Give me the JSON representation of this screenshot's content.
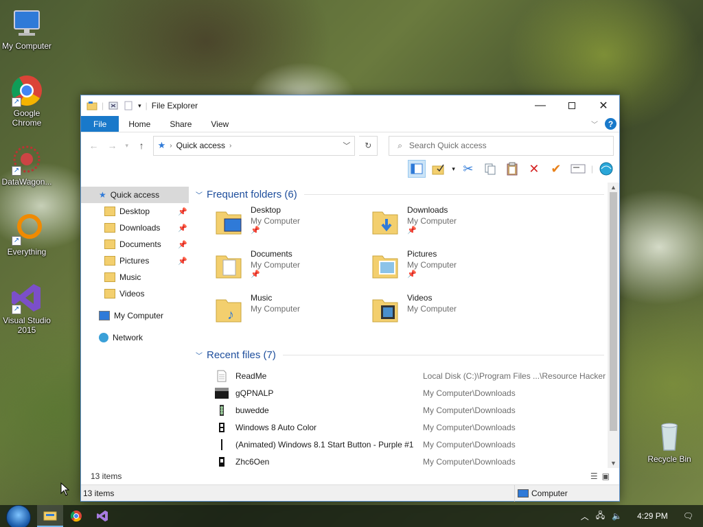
{
  "desktop": {
    "icons": [
      {
        "label": "My Computer"
      },
      {
        "label": "Google Chrome"
      },
      {
        "label": "DataWagon..."
      },
      {
        "label": "Everything"
      },
      {
        "label": "Visual Studio 2015"
      },
      {
        "label": "Recycle Bin"
      }
    ]
  },
  "window": {
    "title": "File Explorer",
    "ribbon_tabs": [
      "File",
      "Home",
      "Share",
      "View"
    ],
    "help": "?",
    "address": {
      "location": "Quick access"
    },
    "search": {
      "placeholder": "Search Quick access"
    },
    "nav": {
      "quick_access": "Quick access",
      "items": [
        "Desktop",
        "Downloads",
        "Documents",
        "Pictures",
        "Music",
        "Videos"
      ],
      "my_computer": "My Computer",
      "network": "Network"
    },
    "frequent": {
      "header": "Frequent folders (6)",
      "folders": [
        {
          "name": "Desktop",
          "location": "My Computer"
        },
        {
          "name": "Downloads",
          "location": "My Computer"
        },
        {
          "name": "Documents",
          "location": "My Computer"
        },
        {
          "name": "Pictures",
          "location": "My Computer"
        },
        {
          "name": "Music",
          "location": "My Computer"
        },
        {
          "name": "Videos",
          "location": "My Computer"
        }
      ]
    },
    "recent": {
      "header": "Recent files (7)",
      "files": [
        {
          "name": "ReadMe",
          "location": "Local Disk (C:)\\Program Files ...\\Resource Hacker"
        },
        {
          "name": "gQPNALP",
          "location": "My Computer\\Downloads"
        },
        {
          "name": "buwedde",
          "location": "My Computer\\Downloads"
        },
        {
          "name": "Windows 8 Auto Color",
          "location": "My Computer\\Downloads"
        },
        {
          "name": "(Animated) Windows 8.1 Start Button - Purple #1",
          "location": "My Computer\\Downloads"
        },
        {
          "name": "Zhc6Oen",
          "location": "My Computer\\Downloads"
        }
      ]
    },
    "items_count": "13 items",
    "status_count": "13 items",
    "status_zone": "Computer"
  },
  "taskbar": {
    "clock": "4:29 PM"
  },
  "colors": {
    "accent": "#1979ca",
    "section_header": "#1e4e9c",
    "folder": "#f3cf6e"
  }
}
